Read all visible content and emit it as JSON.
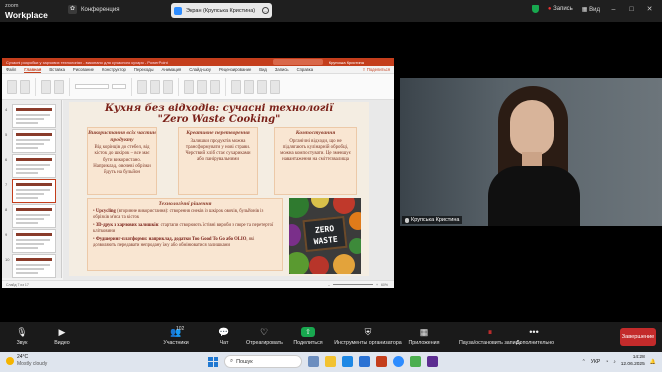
{
  "zoom": {
    "logo_top": "zoom",
    "logo_bottom": "Workplace",
    "conference_label": "Конференция",
    "share_label": "Экран (Крупська Кристина)",
    "record_label": "Запись",
    "view_label": "Вид"
  },
  "powerpoint": {
    "title": "Сучасні розробки у харчових технологіях - виконано для сучасного кухаря - PowerPoint",
    "user": "Крупська Кристина",
    "tabs": [
      "Файл",
      "Главная",
      "Вставка",
      "Рисование",
      "Конструктор",
      "Переходы",
      "Анимация",
      "Слайд-шоу",
      "Рецензирование",
      "Вид",
      "Запись",
      "Справка"
    ],
    "active_tab": "Главная",
    "share_label": "Поделиться",
    "slide_numbers": [
      "4",
      "5",
      "6",
      "7",
      "8",
      "9",
      "10"
    ],
    "selected_slide": "7",
    "status_left": "Слайд 7 из 17",
    "zoom_level": "60%"
  },
  "slide": {
    "title_line1": "Кухня без відходів: сучасні технології",
    "title_line2": "\"Zero Waste Cooking\"",
    "cards": [
      {
        "heading": "Використання всіх частин продукту",
        "text": "Від корінців до стебел, від кісток до шкірок – все має бути використано. Наприклад, овочеві обрізки йдуть на бульйон"
      },
      {
        "heading": "Креативне перетворення",
        "text": "Залишки продуктів можна трансформувати у нові страви. Черствий хліб стає сухариками або панірувальними"
      },
      {
        "heading": "Компостування",
        "text": "Органічні відходи, що не підлягають кулінарній обробці, можна компостувати. Це зменшує навантаження на сміттєзвалища"
      }
    ],
    "solutions_heading": "Технологічні рішення",
    "solutions": [
      {
        "bold": "Upcycling",
        "text": " (вторинне використання): створення снеків із шкірок овочів, бульйонів із обрізків м'яса та кісток"
      },
      {
        "bold": "3D-друк з харчових залишків",
        "text": ": стартапи створюють їстівні вироби з пюре та перетертої клітковини"
      },
      {
        "bold": "Фудшеринг-платформи: наприклад, додатки Too Good To Go або OLIO",
        "text": ", які дозволяють передавати непродану їжу або обмінюватися залишками"
      }
    ],
    "board_text": "ZERO WASTE"
  },
  "participant": {
    "name": "Крупська Кристина"
  },
  "toolbar": {
    "items": [
      {
        "label": "Звук",
        "icon": "mic-icon"
      },
      {
        "label": "Видео",
        "icon": "camera-icon"
      },
      {
        "label": "Участники",
        "icon": "participants-icon",
        "count": "102"
      },
      {
        "label": "Чат",
        "icon": "chat-icon"
      },
      {
        "label": "Отреагировать",
        "icon": "react-icon"
      },
      {
        "label": "Поделиться",
        "icon": "share-icon"
      },
      {
        "label": "Инструменты организатора",
        "icon": "shield-icon"
      },
      {
        "label": "Приложения",
        "icon": "apps-icon"
      },
      {
        "label": "Пауза/остановить запись",
        "icon": "pause-record-icon"
      },
      {
        "label": "Дополнительно",
        "icon": "more-icon"
      }
    ],
    "end_label": "Завершение"
  },
  "taskbar": {
    "temperature": "24°C",
    "weather": "Mostly cloudy",
    "search_placeholder": "Пошук",
    "lang": "УКР",
    "time": "14:28",
    "date": "12.06.2025"
  },
  "colors": {
    "ppt_accent": "#c43e1c",
    "slide_bg": "#f4ede2",
    "card_bg": "#f9e6d2",
    "title_color": "#7a2018",
    "end_button": "#c32b2b"
  }
}
